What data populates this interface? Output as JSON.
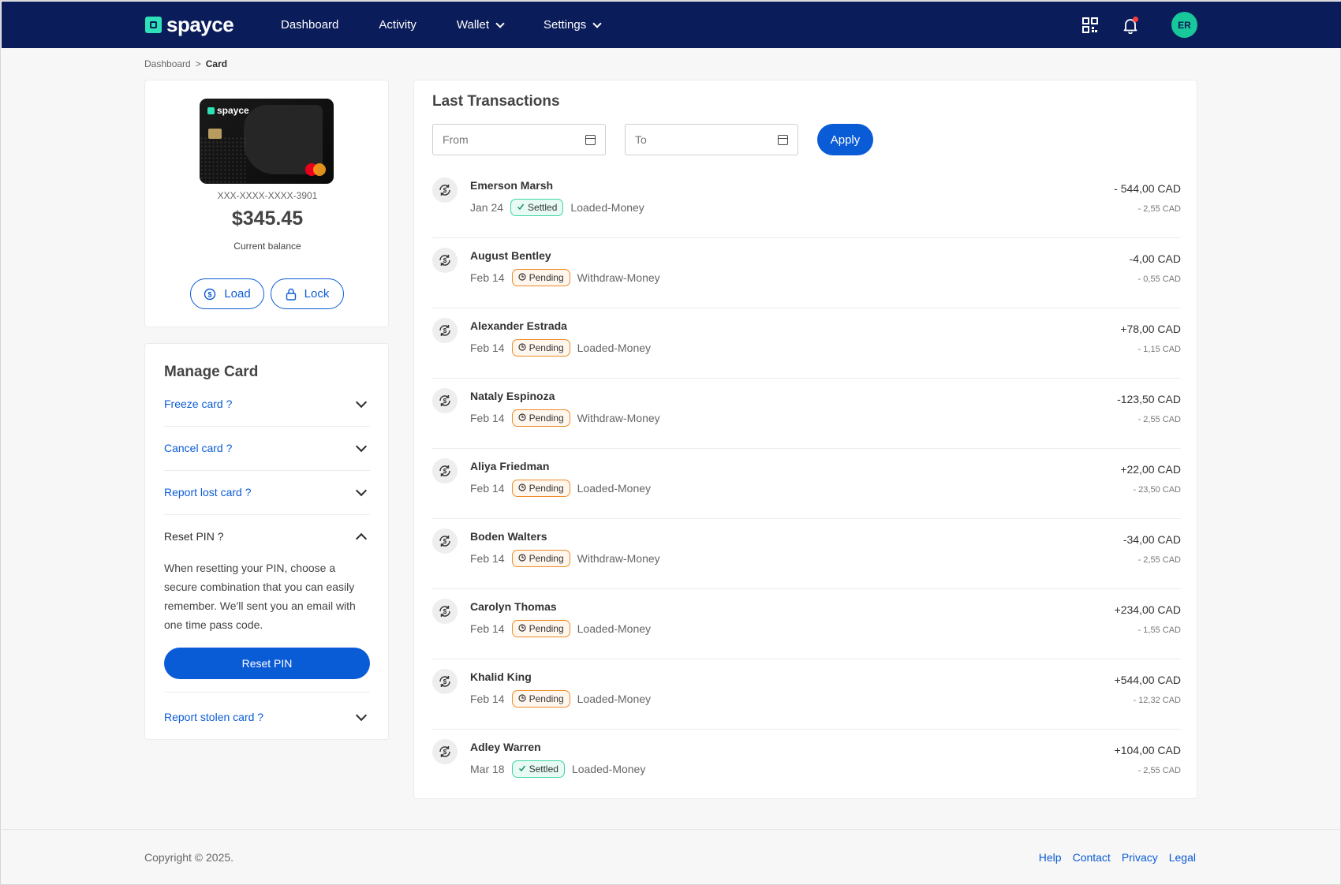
{
  "brand": {
    "name": "spayce",
    "accent": "#2de0b7",
    "primary": "#0a5bd6",
    "header_bg": "#0b1c5a"
  },
  "nav": {
    "items": [
      {
        "label": "Dashboard",
        "has_dropdown": false
      },
      {
        "label": "Activity",
        "has_dropdown": false
      },
      {
        "label": "Wallet",
        "has_dropdown": true
      },
      {
        "label": "Settings",
        "has_dropdown": true
      }
    ],
    "icons": [
      "qr-code-icon",
      "bell-icon"
    ],
    "avatar_initials": "ER"
  },
  "breadcrumb": {
    "parent": "Dashboard",
    "separator": ">",
    "current": "Card"
  },
  "card": {
    "brand_label": "spayce",
    "number": "XXX-XXXX-XXXX-3901",
    "balance": "$345.45",
    "balance_label": "Current balance",
    "load_label": "Load",
    "lock_label": "Lock"
  },
  "manage": {
    "title": "Manage Card",
    "items": [
      {
        "label": "Freeze card ?",
        "open": false
      },
      {
        "label": "Cancel card ?",
        "open": false
      },
      {
        "label": "Report lost card ?",
        "open": false
      },
      {
        "label": "Reset PIN ?",
        "open": true
      },
      {
        "label": "Report stolen card ?",
        "open": false
      }
    ],
    "reset_pin_text": "When resetting your PIN, choose a secure combination that you can easily remember. We'll sent you an email with one time pass code.",
    "reset_pin_button": "Reset PIN"
  },
  "transactions": {
    "title": "Last Transactions",
    "from_placeholder": "From",
    "to_placeholder": "To",
    "apply_label": "Apply",
    "rows": [
      {
        "name": "Emerson Marsh",
        "date": "Jan 24",
        "status": "Settled",
        "type": "Loaded-Money",
        "amount": "- 544,00 CAD",
        "fee": "- 2,55 CAD"
      },
      {
        "name": "August Bentley",
        "date": "Feb 14",
        "status": "Pending",
        "type": "Withdraw-Money",
        "amount": "-4,00 CAD",
        "fee": "- 0,55 CAD"
      },
      {
        "name": "Alexander Estrada",
        "date": "Feb 14",
        "status": "Pending",
        "type": "Loaded-Money",
        "amount": "+78,00 CAD",
        "fee": "- 1,15 CAD"
      },
      {
        "name": "Nataly Espinoza",
        "date": "Feb 14",
        "status": "Pending",
        "type": "Withdraw-Money",
        "amount": "-123,50 CAD",
        "fee": "- 2,55 CAD"
      },
      {
        "name": "Aliya Friedman",
        "date": "Feb 14",
        "status": "Pending",
        "type": "Loaded-Money",
        "amount": "+22,00 CAD",
        "fee": "- 23,50 CAD"
      },
      {
        "name": "Boden Walters",
        "date": "Feb 14",
        "status": "Pending",
        "type": "Withdraw-Money",
        "amount": "-34,00 CAD",
        "fee": "- 2,55 CAD"
      },
      {
        "name": "Carolyn Thomas",
        "date": "Feb 14",
        "status": "Pending",
        "type": "Loaded-Money",
        "amount": "+234,00 CAD",
        "fee": "- 1,55 CAD"
      },
      {
        "name": "Khalid King",
        "date": "Feb 14",
        "status": "Pending",
        "type": "Loaded-Money",
        "amount": "+544,00 CAD",
        "fee": "- 12,32 CAD"
      },
      {
        "name": "Adley Warren",
        "date": "Mar 18",
        "status": "Settled",
        "type": "Loaded-Money",
        "amount": "+104,00 CAD",
        "fee": "- 2,55 CAD"
      }
    ]
  },
  "footer": {
    "copyright": "Copyright © 2025.",
    "links": [
      "Help",
      "Contact",
      "Privacy",
      "Legal"
    ]
  }
}
